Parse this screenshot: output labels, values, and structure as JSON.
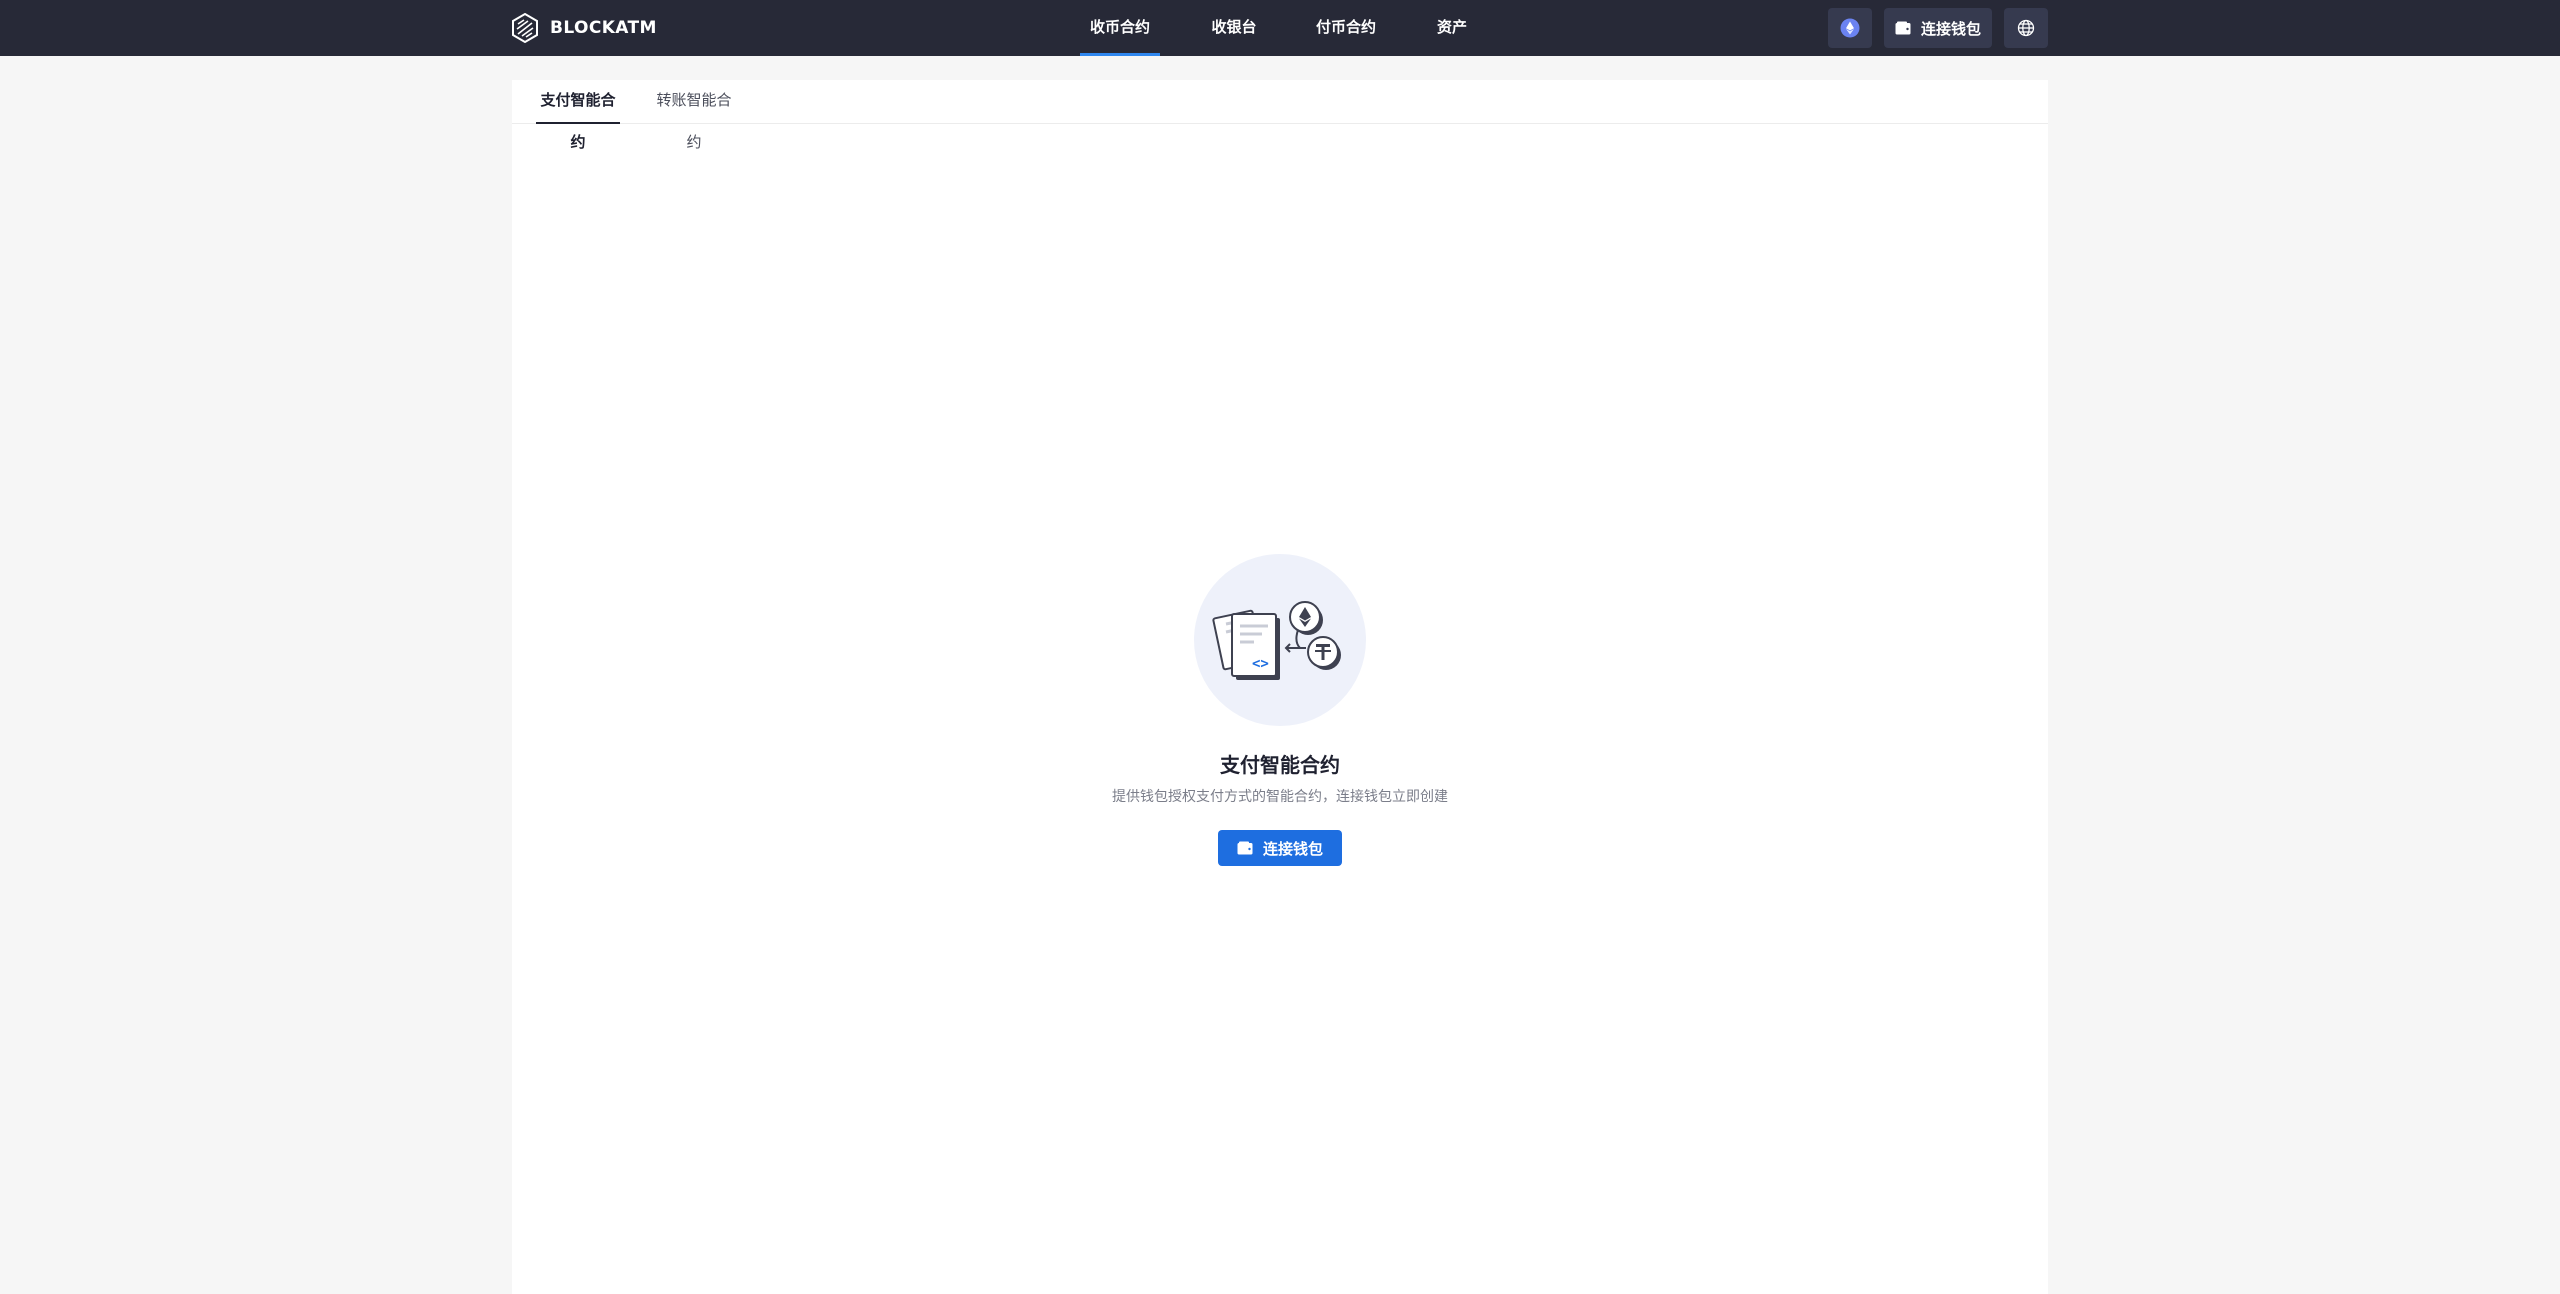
{
  "header": {
    "brand": "BLOCKATM",
    "nav": [
      {
        "label": "收币合约",
        "active": true
      },
      {
        "label": "收银台",
        "active": false
      },
      {
        "label": "付币合约",
        "active": false
      },
      {
        "label": "资产",
        "active": false
      }
    ],
    "network_icon": "ethereum-icon",
    "connect_wallet_label": "连接钱包",
    "language_icon": "globe-icon"
  },
  "tabs": [
    {
      "label": "支付智能合约",
      "active": true
    },
    {
      "label": "转账智能合约",
      "active": false
    }
  ],
  "empty_state": {
    "title": "支付智能合约",
    "description": "提供钱包授权支付方式的智能合约，连接钱包立即创建",
    "button_label": "连接钱包",
    "illustration_icons": [
      "contract-document-icon",
      "ethereum-icon",
      "tether-icon"
    ]
  },
  "colors": {
    "topbar": "#272937",
    "accent": "#1e6ee0",
    "active_nav_underline": "#2f87ef",
    "page_background": "#f6f6f6"
  }
}
